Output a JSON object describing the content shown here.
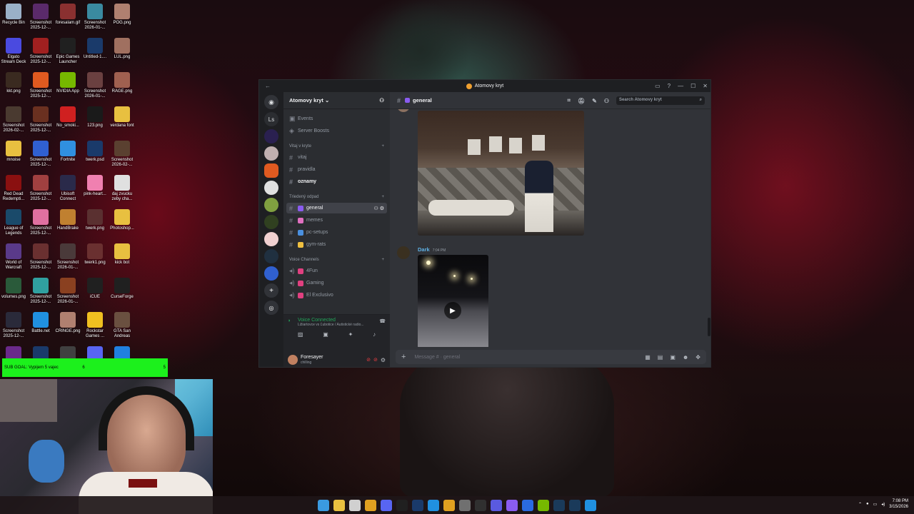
{
  "desktop": {
    "icons": [
      {
        "label": "Recycle Bin",
        "color": "#9ab0c8"
      },
      {
        "label": "Screenshot 2025-12-...",
        "color": "#5a2a6a"
      },
      {
        "label": "foresalam.gif",
        "color": "#8a3030"
      },
      {
        "label": "Screenshot 2026-01-...",
        "color": "#3a8aa0"
      },
      {
        "label": "POG.png",
        "color": "#b08070"
      },
      {
        "label": "Elgato Stream Deck",
        "color": "#4a4ae0"
      },
      {
        "label": "Screenshot 2025-12-...",
        "color": "#a02020"
      },
      {
        "label": "Epic Games Launcher",
        "color": "#202020"
      },
      {
        "label": "Untitled-1....",
        "color": "#1a3a6a"
      },
      {
        "label": "LUL.png",
        "color": "#a07060"
      },
      {
        "label": "kkt.png",
        "color": "#3a2a20"
      },
      {
        "label": "Screenshot 2025-12-...",
        "color": "#e05a20"
      },
      {
        "label": "NVIDIA App",
        "color": "#76b900"
      },
      {
        "label": "Screenshot 2026-01-...",
        "color": "#6a4040"
      },
      {
        "label": "RAGE.png",
        "color": "#a06050"
      },
      {
        "label": "Screenshot 2026-02-...",
        "color": "#4a3a30"
      },
      {
        "label": "Screenshot 2025-12-...",
        "color": "#6a3020"
      },
      {
        "label": "No_smoki...",
        "color": "#d02020"
      },
      {
        "label": "123.png",
        "color": "#1a1a1a"
      },
      {
        "label": "verdana font",
        "color": "#e8c040"
      },
      {
        "label": "mnoise",
        "color": "#e8c040"
      },
      {
        "label": "Screenshot 2025-12-...",
        "color": "#3060d0"
      },
      {
        "label": "Fortnite",
        "color": "#3090e0"
      },
      {
        "label": "twerk.psd",
        "color": "#1a3a6a"
      },
      {
        "label": "Screenshot 2026-02-...",
        "color": "#5a4030"
      },
      {
        "label": "Red Dead Redempti...",
        "color": "#8a1010"
      },
      {
        "label": "Screenshot 2025-12-...",
        "color": "#a04040"
      },
      {
        "label": "Ubisoft Connect",
        "color": "#2a2a4a"
      },
      {
        "label": "pink-heart...",
        "color": "#f080b0"
      },
      {
        "label": "daj zvucku zeby cha...",
        "color": "#e0e0e0"
      },
      {
        "label": "League of Legends",
        "color": "#1a4a6a"
      },
      {
        "label": "Screenshot 2025-12-...",
        "color": "#e070a0"
      },
      {
        "label": "HandBrake",
        "color": "#c08030"
      },
      {
        "label": "twerk.png",
        "color": "#5a3030"
      },
      {
        "label": "Photoshop...",
        "color": "#e8c040"
      },
      {
        "label": "World of Warcraft",
        "color": "#5a3a8a"
      },
      {
        "label": "Screenshot 2025-12-...",
        "color": "#6a3030"
      },
      {
        "label": "Screenshot 2026-01-...",
        "color": "#4a3a3a"
      },
      {
        "label": "twerk1.png",
        "color": "#6a3030"
      },
      {
        "label": "kick bot",
        "color": "#e8c040"
      },
      {
        "label": "volumes.png",
        "color": "#2a5a3a"
      },
      {
        "label": "Screenshot 2025-12-...",
        "color": "#30a0a0"
      },
      {
        "label": "Screenshot 2026-01-...",
        "color": "#8a4020"
      },
      {
        "label": "iCUE",
        "color": "#202020"
      },
      {
        "label": "CurseForge",
        "color": "#202020"
      },
      {
        "label": "Screenshot 2025-12-...",
        "color": "#2a2a3a"
      },
      {
        "label": "Battle.net",
        "color": "#2090e0"
      },
      {
        "label": "CRINGE.png",
        "color": "#b08070"
      },
      {
        "label": "Rockstar Games ...",
        "color": "#f0c020"
      },
      {
        "label": "GTA San Andreas",
        "color": "#6a5040"
      },
      {
        "label": "",
        "color": "#6a2a8a"
      },
      {
        "label": "",
        "color": "#1a3a6a"
      },
      {
        "label": "",
        "color": "#404040"
      },
      {
        "label": "",
        "color": "#5865f2"
      },
      {
        "label": "",
        "color": "#2080e0"
      }
    ]
  },
  "overlay": {
    "subgoal_text": "SUB GOAL: Vypijem 5 vajec",
    "subgoal_current": "6",
    "subgoal_target": "5"
  },
  "window": {
    "title": "Atomovy kryt",
    "back_glyph": "←",
    "controls": [
      "▭",
      "?",
      "—",
      "☐",
      "✕"
    ]
  },
  "guilds": {
    "home_label": "Ls"
  },
  "server": {
    "name": "Atomovy kryt",
    "chevron": "⌄",
    "top_items": [
      "Events",
      "Server Boosts"
    ],
    "categories": [
      {
        "name": "Vitaj v kryte",
        "channels": [
          {
            "name": "vitaj",
            "emoji_color": "",
            "active": false,
            "bold": false
          },
          {
            "name": "pravidla",
            "emoji_color": "",
            "active": false,
            "bold": false
          },
          {
            "name": "oznamy",
            "emoji_color": "",
            "active": false,
            "bold": true
          }
        ]
      },
      {
        "name": "Triedený odpad",
        "channels": [
          {
            "name": "general",
            "emoji_color": "#8a5cf0",
            "active": true,
            "bold": false
          },
          {
            "name": "memes",
            "emoji_color": "#e070c0",
            "active": false,
            "bold": false
          },
          {
            "name": "pc-setups",
            "emoji_color": "#4a90e0",
            "active": false,
            "bold": false
          },
          {
            "name": "gym-rats",
            "emoji_color": "#f0c040",
            "active": false,
            "bold": false
          }
        ]
      }
    ],
    "voice_category": "Voice Channels",
    "voice_channels": [
      {
        "name": "4Fun",
        "emoji_color": "#e04080"
      },
      {
        "name": "Gaming",
        "emoji_color": "#e04080"
      },
      {
        "name": "El Exclusivo",
        "emoji_color": "#e04080"
      }
    ]
  },
  "voice": {
    "status": "Voice Connected",
    "detail": "Ližiartovce vs Ľubotice / Autistické radio..."
  },
  "user": {
    "name": "Foresayer",
    "status": "chilling"
  },
  "channel": {
    "name": "general",
    "search_placeholder": "Search Atomovy kryt"
  },
  "messages": {
    "author": "Dark",
    "time": "7:04 PM"
  },
  "composer": {
    "placeholder": "Message #  · general"
  },
  "taskbar": {
    "time": "7:08 PM",
    "date": "3/15/2026",
    "apps": [
      {
        "icon": "windows-icon",
        "color": "#3a9ae0"
      },
      {
        "icon": "folder-icon",
        "color": "#e8c040"
      },
      {
        "icon": "notepad-icon",
        "color": "#d0d0d0"
      },
      {
        "icon": "sticky-icon",
        "color": "#e0a020"
      },
      {
        "icon": "discord-icon",
        "color": "#5865f2"
      },
      {
        "icon": "x-icon",
        "color": "#202020"
      },
      {
        "icon": "ps-icon",
        "color": "#1a3a6a"
      },
      {
        "icon": "battlenet-icon",
        "color": "#2090e0"
      },
      {
        "icon": "chrome-icon",
        "color": "#e0a020"
      },
      {
        "icon": "gear-icon",
        "color": "#707070"
      },
      {
        "icon": "obs-icon",
        "color": "#303030"
      },
      {
        "icon": "teams-icon",
        "color": "#5a5ae0"
      },
      {
        "icon": "vs-icon",
        "color": "#8a5cf0"
      },
      {
        "icon": "tool-icon",
        "color": "#2a6ae0"
      },
      {
        "icon": "nvidia-icon",
        "color": "#76b900"
      },
      {
        "icon": "steam-icon",
        "color": "#1a3a5a"
      },
      {
        "icon": "steam2-icon",
        "color": "#1a3a5a"
      },
      {
        "icon": "battlenet2-icon",
        "color": "#2090e0"
      }
    ]
  }
}
